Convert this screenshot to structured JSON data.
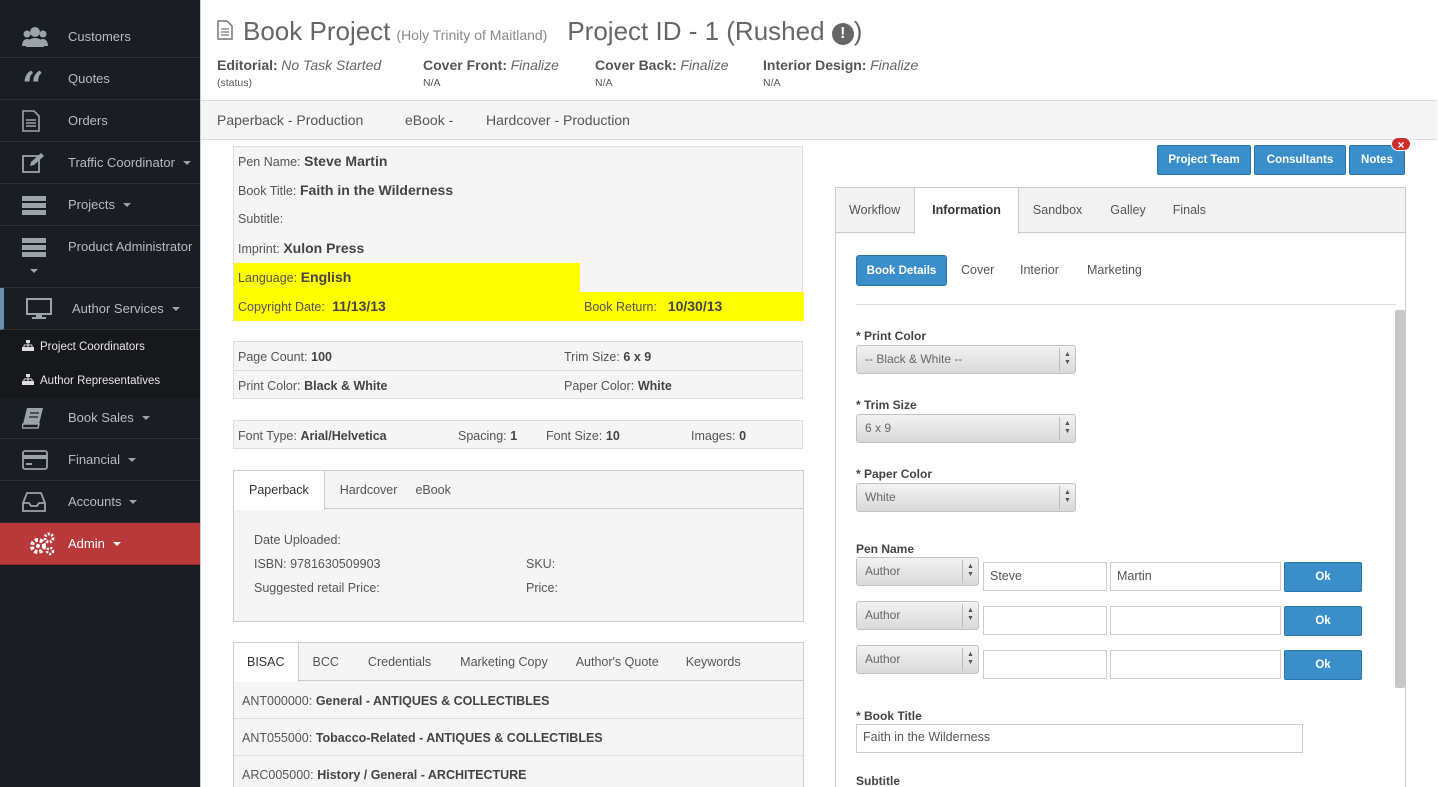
{
  "sidebar": {
    "items": [
      {
        "label": "Customers",
        "icon": "users-icon"
      },
      {
        "label": "Quotes",
        "icon": "quote-icon"
      },
      {
        "label": "Orders",
        "icon": "document-icon"
      },
      {
        "label": "Traffic Coordinator",
        "icon": "edit-icon"
      },
      {
        "label": "Projects",
        "icon": "list-icon"
      },
      {
        "label": "Product Administrator",
        "icon": "list-icon"
      },
      {
        "label": "Author Services",
        "icon": "monitor-icon"
      },
      {
        "label": "Book Sales",
        "icon": "book-icon"
      },
      {
        "label": "Financial",
        "icon": "credit-card-icon"
      },
      {
        "label": "Accounts",
        "icon": "inbox-icon"
      },
      {
        "label": "Admin",
        "icon": "gears-icon"
      }
    ],
    "subitems": [
      {
        "label": "Project Coordinators",
        "icon": "sitemap-icon"
      },
      {
        "label": "Author Representatives",
        "icon": "sitemap-icon"
      }
    ],
    "colors": {
      "background": "#1a1d21",
      "admin": "#b9393a"
    }
  },
  "header": {
    "title": "Book Project",
    "church": "(Holy Trinity of Maitland)",
    "project_id": "Project ID - 1 (Rushed",
    "project_id_end": ")",
    "status": [
      {
        "key": "Editorial:",
        "value": "No Task Started",
        "sub": "(status)"
      },
      {
        "key": "Cover Front:",
        "value": "Finalize",
        "sub": "N/A"
      },
      {
        "key": "Cover Back:",
        "value": "Finalize",
        "sub": "N/A"
      },
      {
        "key": "Interior Design:",
        "value": "Finalize",
        "sub": "N/A"
      }
    ]
  },
  "subnav": [
    "Paperback - Production",
    "eBook -",
    "Hardcover - Production"
  ],
  "book_info": {
    "pen_name_label": "Pen Name:",
    "pen_name": "Steve Martin",
    "book_title_label": "Book Title:",
    "book_title": "Faith in the Wilderness",
    "subtitle_label": "Subtitle:",
    "imprint_label": "Imprint:",
    "imprint": "Xulon Press",
    "language_label": "Language:",
    "language": "English",
    "copyright_label": "Copyright Date:",
    "copyright": "11/13/13",
    "return_label": "Book Return:",
    "return": "10/30/13"
  },
  "specs": {
    "page_count_label": "Page Count:",
    "page_count": "100",
    "trim_label": "Trim Size:",
    "trim": "6 x 9",
    "print_color_label": "Print Color:",
    "print_color": "Black & White",
    "paper_color_label": "Paper Color:",
    "paper_color": "White"
  },
  "fonts": {
    "font_type_label": "Font Type:",
    "font_type": "Arial/Helvetica",
    "spacing_label": "Spacing:",
    "spacing": "1",
    "font_size_label": "Font Size:",
    "font_size": "10",
    "images_label": "Images:",
    "images": "0"
  },
  "format_tabs": [
    "Paperback",
    "Hardcover",
    "eBook"
  ],
  "format_panel": {
    "date_uploaded": "Date Uploaded:",
    "isbn": "ISBN: 9781630509903",
    "sku": "SKU:",
    "suggested": "Suggested retail Price:",
    "price": "Price:"
  },
  "bisac_tabs": [
    "BISAC",
    "BCC",
    "Credentials",
    "Marketing Copy",
    "Author's Quote",
    "Keywords"
  ],
  "bisac_rows": [
    {
      "code": "ANT000000:",
      "desc": "General - ANTIQUES & COLLECTIBLES"
    },
    {
      "code": "ANT055000:",
      "desc": "Tobacco-Related - ANTIQUES & COLLECTIBLES"
    },
    {
      "code": "ARC005000:",
      "desc": "History / General - ARCHITECTURE"
    }
  ],
  "buttons": {
    "team": "Project Team",
    "consultants": "Consultants",
    "notes": "Notes",
    "close": "×"
  },
  "right_tabs": [
    "Workflow",
    "Information",
    "Sandbox",
    "Galley",
    "Finals"
  ],
  "pill_tabs": [
    "Book Details",
    "Cover",
    "Interior",
    "Marketing"
  ],
  "form": {
    "print_color_label": "* Print Color",
    "print_color": "-- Black & White --",
    "trim_label": "* Trim Size",
    "trim": "6 x 9",
    "paper_label": "* Paper Color",
    "paper": "White",
    "pen_name_label": "Pen Name",
    "pen_rows": [
      {
        "role": "Author",
        "first": "Steve",
        "last": "Martin",
        "ok": "Ok"
      },
      {
        "role": "Author",
        "first": "",
        "last": "",
        "ok": "Ok"
      },
      {
        "role": "Author",
        "first": "",
        "last": "",
        "ok": "Ok"
      }
    ],
    "book_title_label": "* Book Title",
    "book_title": "Faith in the Wilderness",
    "subtitle_label": "Subtitle"
  },
  "colors": {
    "accent": "#3a8ec9",
    "highlight": "#ffff00"
  }
}
